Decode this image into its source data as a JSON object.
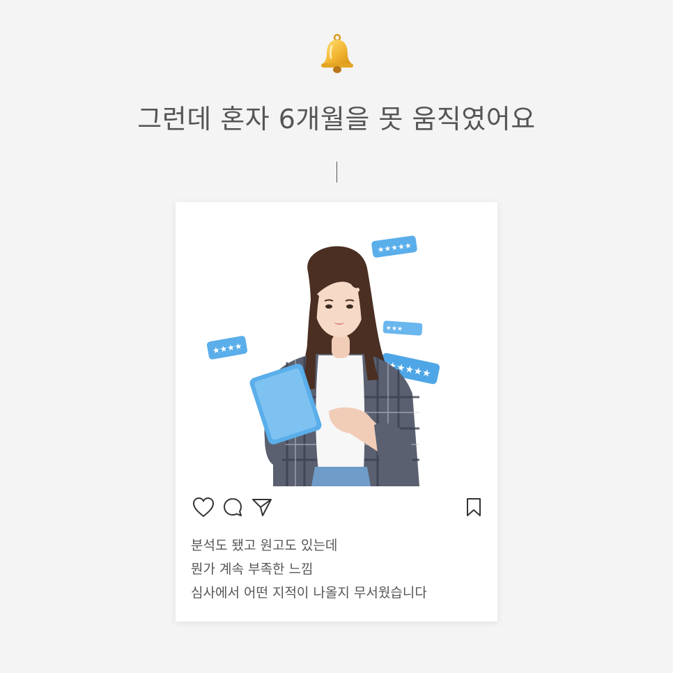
{
  "icons": {
    "header": "bell-icon",
    "like": "heart-icon",
    "comment": "comment-icon",
    "share": "send-icon",
    "save": "bookmark-icon"
  },
  "headline": "그런데 혼자 6개월을 못 움직였어요",
  "post": {
    "caption_lines": [
      "분석도 됐고 원고도 있는데",
      "뭔가 계속 부족한 느낌",
      "심사에서 어떤 지적이 나올지 무서웠습니다"
    ]
  },
  "colors": {
    "background": "#f4f4f4",
    "card": "#ffffff",
    "text": "#555555",
    "accent_blue": "#5aaeea",
    "bell_gold": "#f2b632"
  }
}
